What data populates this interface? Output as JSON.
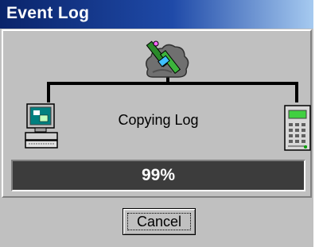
{
  "window": {
    "title": "Event Log"
  },
  "dialog": {
    "status": "Copying Log",
    "progress": {
      "value": 99,
      "label": "99%"
    }
  },
  "buttons": {
    "cancel_label": "Cancel"
  },
  "icons": {
    "center": "network-hub-icon",
    "left": "computer-icon",
    "right": "terminal-device-icon"
  },
  "colors": {
    "title_start": "#0a246a",
    "title_end": "#a6caf0",
    "face": "#c0c0c0",
    "progress_bg": "#3c3c3c",
    "progress_text": "#ffffff"
  }
}
